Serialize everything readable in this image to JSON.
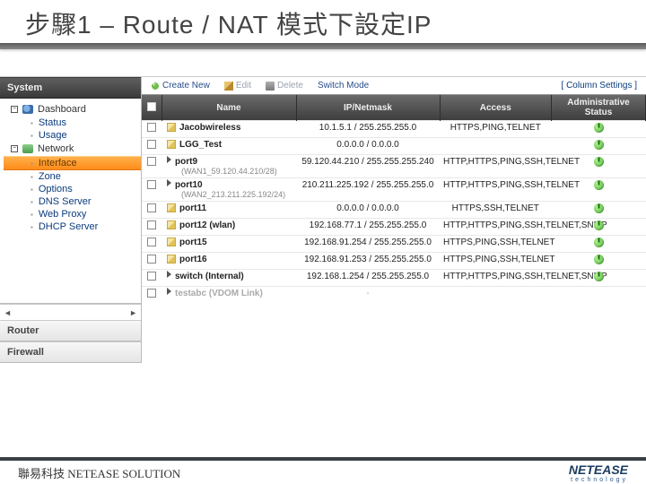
{
  "title": "步驟1 – Route / NAT 模式下設定IP",
  "sidebar": {
    "head": "System",
    "dashboard": "Dashboard",
    "dash_children": [
      "Status",
      "Usage"
    ],
    "network": "Network",
    "net_children": [
      "Interface",
      "Zone",
      "Options",
      "DNS Server",
      "Web Proxy",
      "DHCP Server"
    ],
    "selected_index": 0,
    "sections": [
      "Router",
      "Firewall"
    ]
  },
  "toolbar": {
    "create": "Create New",
    "edit": "Edit",
    "delete": "Delete",
    "switch": "Switch Mode",
    "colset": "[ Column Settings ]"
  },
  "columns": [
    "",
    "Name",
    "IP/Netmask",
    "Access",
    "Administrative Status"
  ],
  "rows": [
    {
      "name": "Jacobwireless",
      "sub": "",
      "ip": "10.1.5.1 / 255.255.255.0",
      "access": "HTTPS,PING,TELNET",
      "status": true
    },
    {
      "name": "LGG_Test",
      "sub": "",
      "ip": "0.0.0.0 / 0.0.0.0",
      "access": "",
      "status": true
    },
    {
      "name": "port9",
      "sub": "(WAN1_59.120.44.210/28)",
      "ip": "59.120.44.210 / 255.255.255.240",
      "access": "HTTP,HTTPS,PING,SSH,TELNET",
      "status": true,
      "expand": true
    },
    {
      "name": "port10",
      "sub": "(WAN2_213.211.225.192/24)",
      "ip": "210.211.225.192 / 255.255.255.0",
      "access": "HTTP,HTTPS,PING,SSH,TELNET",
      "status": true,
      "expand": true
    },
    {
      "name": "port11",
      "sub": "",
      "ip": "0.0.0.0 / 0.0.0.0",
      "access": "HTTPS,SSH,TELNET",
      "status": true
    },
    {
      "name": "port12 (wlan)",
      "sub": "",
      "ip": "192.168.77.1 / 255.255.255.0",
      "access": "HTTP,HTTPS,PING,SSH,TELNET,SNMP",
      "status": true
    },
    {
      "name": "port15",
      "sub": "",
      "ip": "192.168.91.254 / 255.255.255.0",
      "access": "HTTPS,PING,SSH,TELNET",
      "status": true
    },
    {
      "name": "port16",
      "sub": "",
      "ip": "192.168.91.253 / 255.255.255.0",
      "access": "HTTPS,PING,SSH,TELNET",
      "status": true
    },
    {
      "name": "switch (Internal)",
      "sub": "",
      "ip": "192.168.1.254 / 255.255.255.0",
      "access": "HTTP,HTTPS,PING,SSH,TELNET,SNMP",
      "status": true,
      "expand": true
    },
    {
      "name": "testabc (VDOM Link)",
      "sub": "",
      "ip": "-",
      "access": "",
      "status": false,
      "expand": true,
      "dim": true
    }
  ],
  "footer": {
    "left": "聯易科技  NETEASE SOLUTION",
    "brand": "NETEASE",
    "brand_sub": "technology"
  }
}
